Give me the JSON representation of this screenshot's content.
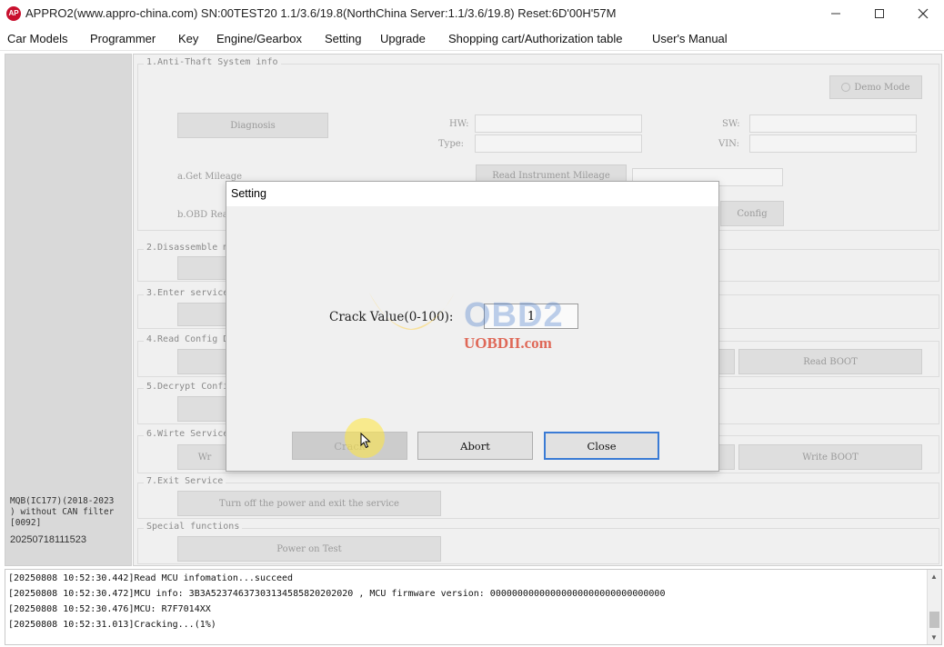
{
  "window": {
    "logo_text": "AP",
    "title": "APPRO2(www.appro-china.com)  SN:00TEST20  1.1/3.6/19.8(NorthChina Server:1.1/3.6/19.8)  Reset:6D'00H'57M"
  },
  "menu": [
    "Car Models",
    "Programmer",
    "Key",
    "Engine/Gearbox",
    "Setting",
    "Upgrade",
    "Shopping cart/Authorization table",
    "User's Manual"
  ],
  "left_panel": {
    "description": "MQB(IC177)(2018-2023\n) without CAN filter\n[0092]",
    "date": "20250718111523"
  },
  "sections": {
    "s1": "1.Anti-Thaft System info",
    "s2": "2.Disassemble m",
    "s3": "3.Enter service",
    "s4": "4.Read Config D",
    "s5": "5.Decrypt Confi",
    "s6": "6.Wirte Service",
    "s7": "7.Exit Service",
    "special": "Special functions"
  },
  "background_controls": {
    "demo_mode": "Demo Mode",
    "diagnosis": "Diagnosis",
    "hw_label": "HW:",
    "type_label": "Type:",
    "sw_label": "SW:",
    "vin_label": "VIN:",
    "get_mileage": "a.Get Mileage",
    "obd_read": "b.OBD Rea",
    "read_instrument_mileage": "Read Instrument Mileage",
    "config": "Config",
    "read_boot": "Read BOOT",
    "write_boot": "Write BOOT",
    "write_prefix": "Wr",
    "turn_off": "Turn off the power and exit the service",
    "power_on_test": "Power on Test"
  },
  "dialog": {
    "title": "Setting",
    "crack_label": "Crack Value(0-100):",
    "crack_value": "1",
    "crack_button": "Crack",
    "abort_button": "Abort",
    "close_button": "Close"
  },
  "watermark": {
    "brand": "OBD2",
    "site": "UOBDII.com"
  },
  "log": [
    "[20250808 10:52:30.442]Read MCU infomation...succeed",
    "[20250808 10:52:30.472]MCU info: 3B3A52374637303134585820202020 , MCU firmware version: 00000000000000000000000000000000",
    "[20250808 10:52:30.476]MCU: R7F7014XX",
    "[20250808 10:52:31.013]Cracking...(1%)"
  ]
}
